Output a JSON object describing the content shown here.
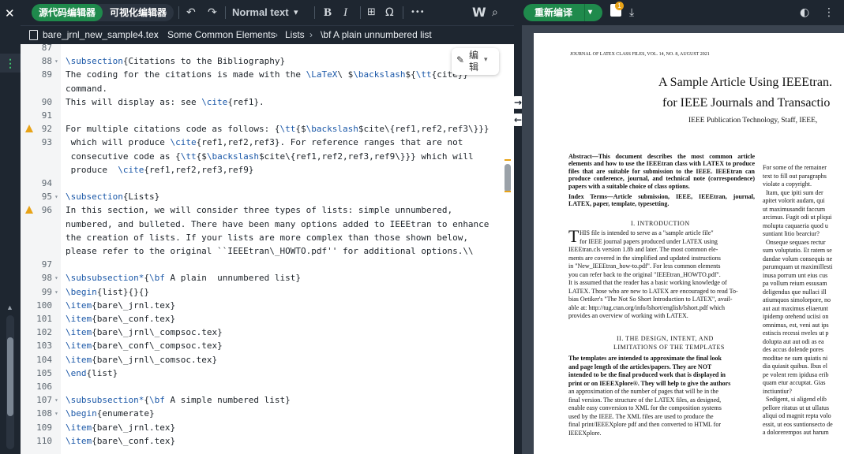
{
  "toolbar": {
    "mode_source": "源代码编辑器",
    "mode_visual": "可视化编辑器",
    "undo_icon": "undo-icon",
    "redo_icon": "redo-icon",
    "text_style": "Normal text",
    "bold": "B",
    "italic": "I",
    "omega": "Ω",
    "more": "•••"
  },
  "breadcrumb": {
    "file": "bare_jrnl_new_sample4.tex",
    "items": [
      "Some Common Elements",
      "Lists",
      "\\bf A plain unnumbered list"
    ]
  },
  "edit_button": {
    "label": "编辑"
  },
  "editor_lines": [
    {
      "n": "87",
      "t": ""
    },
    {
      "n": "88",
      "t": "\\subsection{Citations to the Bibliography}"
    },
    {
      "n": "89",
      "t": "The coding for the citations is made with the \\LaTeX\\ $\\backslash${\\tt{cite}}"
    },
    {
      "n": "",
      "t": "command."
    },
    {
      "n": "90",
      "t": "This will display as: see \\cite{ref1}."
    },
    {
      "n": "91",
      "t": ""
    },
    {
      "n": "92",
      "t": "For multiple citations code as follows: {\\tt{$\\backslash$cite\\{ref1,ref2,ref3\\}}}"
    },
    {
      "n": "93",
      "t": " which will produce \\cite{ref1,ref2,ref3}. For reference ranges that are not"
    },
    {
      "n": "",
      "t": " consecutive code as {\\tt{$\\backslash$cite\\{ref1,ref2,ref3,ref9\\}}} which will"
    },
    {
      "n": "",
      "t": " produce  \\cite{ref1,ref2,ref3,ref9}"
    },
    {
      "n": "94",
      "t": ""
    },
    {
      "n": "95",
      "t": "\\subsection{Lists}"
    },
    {
      "n": "96",
      "t": "In this section, we will consider three types of lists: simple unnumbered,"
    },
    {
      "n": "",
      "t": "numbered, and bulleted. There have been many options added to IEEEtran to enhance"
    },
    {
      "n": "",
      "t": "the creation of lists. If your lists are more complex than those shown below,"
    },
    {
      "n": "",
      "t": "please refer to the original ``IEEEtran\\_HOWTO.pdf'' for additional options.\\\\"
    },
    {
      "n": "97",
      "t": ""
    },
    {
      "n": "98",
      "t": "\\subsubsection*{\\bf A plain  unnumbered list}"
    },
    {
      "n": "99",
      "t": "\\begin{list}{}{}"
    },
    {
      "n": "100",
      "t": "\\item{bare\\_jrnl.tex}"
    },
    {
      "n": "101",
      "t": "\\item{bare\\_conf.tex}"
    },
    {
      "n": "102",
      "t": "\\item{bare\\_jrnl\\_compsoc.tex}"
    },
    {
      "n": "103",
      "t": "\\item{bare\\_conf\\_compsoc.tex}"
    },
    {
      "n": "104",
      "t": "\\item{bare\\_jrnl\\_comsoc.tex}"
    },
    {
      "n": "105",
      "t": "\\end{list}"
    },
    {
      "n": "106",
      "t": ""
    },
    {
      "n": "107",
      "t": "\\subsubsection*{\\bf A simple numbered list}"
    },
    {
      "n": "108",
      "t": "\\begin{enumerate}"
    },
    {
      "n": "109",
      "t": "\\item{bare\\_jrnl.tex}"
    },
    {
      "n": "110",
      "t": "\\item{bare\\_conf.tex}"
    }
  ],
  "pdf": {
    "recompile": "重新编译",
    "log_count": "1",
    "header": "JOURNAL OF LATEX CLASS FILES, VOL. 14, NO. 8, AUGUST 2021",
    "title1": "A Sample Article Using IEEEtran.",
    "title2": "for IEEE Journals and Transactio",
    "authors": "IEEE Publication Technology, Staff, IEEE,",
    "abstract": "Abstract—This document describes the most common article elements and how to use the IEEEtran class with LATEX to produce files that are suitable for submission to the IEEE. IEEEtran can produce conference, journal, and technical note (correspondence) papers with a suitable choice of class options.",
    "index_terms": "Index Terms—Article submission, IEEE, IEEEtran, journal, LATEX, paper, template, typesetting.",
    "sec1": "I. INTRODUCTION",
    "intro_lines": [
      "HIS file is intended to serve as a \"sample article file\"",
      "for IEEE journal papers produced under LATEX using",
      "IEEEtran.cls version 1.8b and later. The most common ele-",
      "ments are covered in the simplified and updated instructions",
      "in \"New_IEEEtran_how-to.pdf\". For less common elements",
      "you can refer back to the original \"IEEEtran_HOWTO.pdf\".",
      "It is assumed that the reader has a basic working knowledge of",
      "LATEX. Those who are new to LATEX are encouraged to read To-",
      "bias Oetiker's \"The Not So Short Introduction to LATEX\", avail-",
      "able at: http://tug.ctan.org/info/lshort/english/lshort.pdf which",
      "provides an overview of working with LATEX."
    ],
    "sec2a": "II. THE DESIGN, INTENT, AND",
    "sec2b": "LIMITATIONS OF THE TEMPLATES",
    "design_lines": [
      "The templates are intended to approximate the final look",
      "and page length of the articles/papers. They are NOT",
      "intended to be the final produced work that is displayed in",
      "print or on IEEEXplore®. They will help to give the authors",
      "an approximation of the number of pages that will be in the",
      "final version. The structure of the LATEX files, as designed,",
      "enable easy conversion to XML for the composition systems",
      "used by the IEEE. The XML files are used to produce the",
      "final print/IEEEXplore pdf and then converted to HTML for",
      "IEEEXplore."
    ],
    "right_lines": [
      "For some of the remainer",
      "text to fill out paragraphs",
      "violate a copyright.",
      "  Itam, que ipiti sum der",
      "apitet volorit audam, qui",
      "ut maximusandit faccum",
      "arcimus. Fugit odi ut pliqui",
      "molupta caquaeria quod u",
      "suntiant litio bearciur?",
      "  Onseque sequaes rectur",
      "sum voluptatio. Et ratem se",
      "dandae volum consequis ne",
      "parumquam ut maximillesti",
      "inusa porrum unt eius cus",
      "pa vollum reium essusam",
      "deligendus que nullaci ill",
      "atiumquos simolorpore, no",
      "aut aut maximus eliaerunt",
      "ipidemp orehend uciisi on",
      "omnimus, est, veni aut ips",
      "estiscis recessi nveles ut p",
      "dolupta aut aut odi as ea",
      "des accus dolende pores",
      "moditae ne sum quiatis ni",
      "dia quiasit quibus. Ibus el",
      "pe volent rem ipidusa erib",
      "quam etur accuptat. Gias ",
      "inctiuntiur?",
      "  Sedigent, si aligend elib",
      "pellore ritatus ut ut ullatus",
      "aliqui od magnit repta volo",
      "essit, ut eos suntionsecto de",
      "a dolorerempos aut harum"
    ]
  },
  "colors": {
    "accent": "#1f8a4c",
    "chrome": "#1e2630",
    "warning": "#e8a317"
  }
}
